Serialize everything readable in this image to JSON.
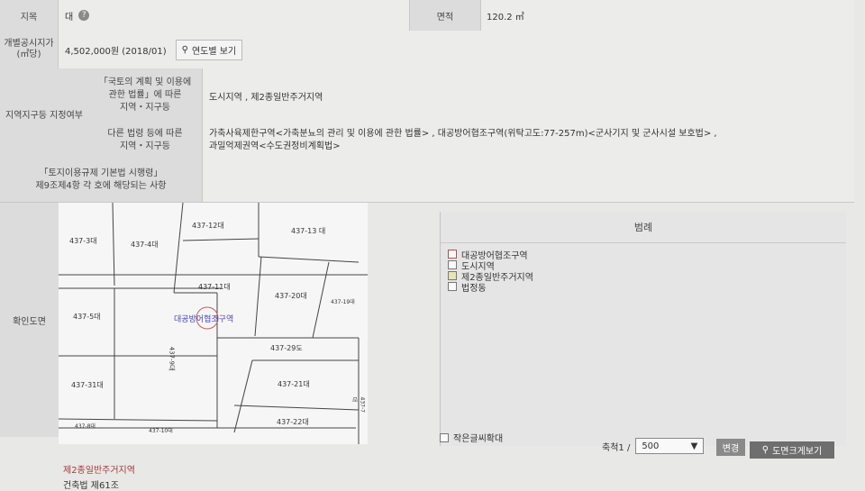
{
  "land": {
    "jimok_label": "지목",
    "jimok_value": "대",
    "area_label": "면적",
    "area_value": "120.2 ㎡",
    "price_label": "개별공시지가\n(㎡당)",
    "price_value": "4,502,000원 (2018/01)",
    "year_btn": "연도별 보기"
  },
  "zoning": {
    "section_label": "지역지구등 지정여부",
    "national_law_label": "「국토의 계획 및 이용에\n관한 법률」에 따른\n지역・지구등",
    "national_law_value": "도시지역 , 제2종일반주거지역",
    "other_law_label": "다른 법령 등에 따른\n지역・지구등",
    "other_law_value": "가축사육제한구역<가축분뇨의 관리 및 이용에 관한 법률> , 대공방어협조구역(위탁고도:77-257m)<군사기지 및 군사시설 보호법> ,\n과밀억제권역<수도권정비계획법>",
    "regulation_label": "「토지이용규제 기본법 시행령」\n제9조제4항 각 호에 해당되는 사항"
  },
  "map": {
    "section_label": "확인도면",
    "parcels": [
      "437-3대",
      "437-4대",
      "437-12대",
      "437-13 대",
      "437-11대",
      "437-20대",
      "437-19대",
      "437-5대",
      "437-29도",
      "437-9대",
      "437-31대",
      "437-21대",
      "437-22대",
      "437-8대",
      "437-10대",
      "437-7대"
    ],
    "overlay_text": "대공방어협조구역"
  },
  "legend": {
    "title": "범례",
    "items": [
      "대공방어협조구역",
      "도시지역",
      "제2종일반주거지역",
      "법정동"
    ],
    "small_text_label": "작은글씨확대",
    "scale_label": "축척1 /",
    "scale_value": "500",
    "change_btn": "변경",
    "enlarge_btn": "도면크게보기"
  },
  "bottom": {
    "zone_title": "제2종일반주거지역",
    "law_line": "건축법 제61조"
  }
}
